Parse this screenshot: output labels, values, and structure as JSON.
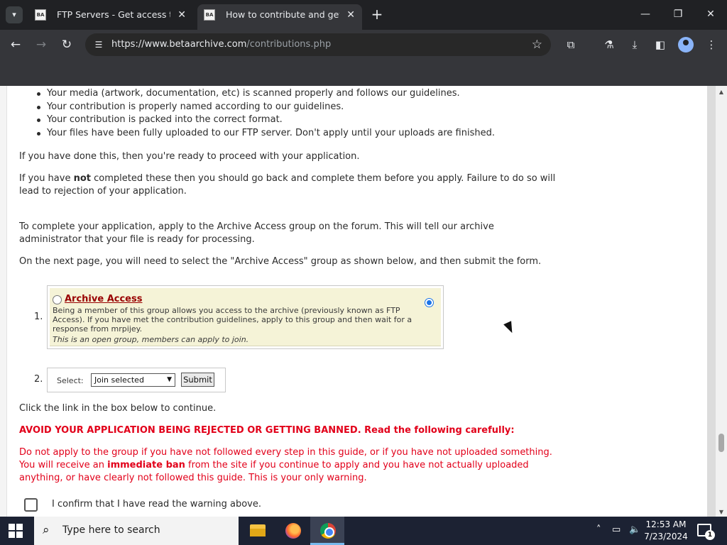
{
  "browser": {
    "tabs": [
      {
        "title": "FTP Servers - Get access to the",
        "favicon": "BA"
      },
      {
        "title": "How to contribute and get acc",
        "favicon": "BA"
      }
    ],
    "url_host": "https://www.betaarchive.com",
    "url_path": "/contributions.php",
    "new_tab_glyph": "+",
    "close_glyph": "✕"
  },
  "page": {
    "bullets": [
      "Your media (artwork, documentation, etc) is scanned properly and follows our guidelines.",
      "Your contribution is properly named according to our guidelines.",
      "Your contribution is packed into the correct format.",
      "Your files have been fully uploaded to our FTP server. Don't apply until your uploads are finished."
    ],
    "ready_text": "If you have done this, then you're ready to proceed with your application.",
    "not_completed": {
      "pre": "If you have ",
      "bold": "not",
      "post": " completed these then you should go back and complete them before you apply. Failure to do so will lead to rejection of your application."
    },
    "apply_text": "To complete your application, apply to the Archive Access group on the forum. This will tell our archive administrator that your file is ready for processing.",
    "next_page_text": "On the next page, you will need to select the \"Archive Access\" group as shown below, and then submit the form.",
    "step1": {
      "number": "1.",
      "group_name": "Archive Access",
      "description": "Being a member of this group allows you access to the archive (previously known as FTP Access). If you have met the contribution guidelines, apply to this group and then wait for a response from mrpijey.",
      "note": "This is an open group, members can apply to join."
    },
    "step2": {
      "number": "2.",
      "select_label": "Select:",
      "select_value": "Join selected",
      "submit_label": "Submit"
    },
    "click_link_text": "Click the link in the box below to continue.",
    "warning_heading": "AVOID YOUR APPLICATION BEING REJECTED OR GETTING BANNED. Read the following carefully:",
    "warning": {
      "pre": "Do not apply to the group if you have not followed every step in this guide, or if you have not uploaded something. You will receive an ",
      "bold": "immediate ban",
      "post": " from the site if you continue to apply and you have not actually uploaded anything, or have clearly not followed this guide. This is your only warning."
    },
    "confirm_text": "I confirm that I have read the warning above."
  },
  "taskbar": {
    "search_placeholder": "Type here to search",
    "time": "12:53 AM",
    "date": "7/23/2024",
    "notification_count": "1"
  },
  "colors": {
    "warning_red": "#e2001a",
    "group_link": "#990000",
    "group_bg": "#f5f3d7",
    "accent_blue": "#1a73e8"
  }
}
